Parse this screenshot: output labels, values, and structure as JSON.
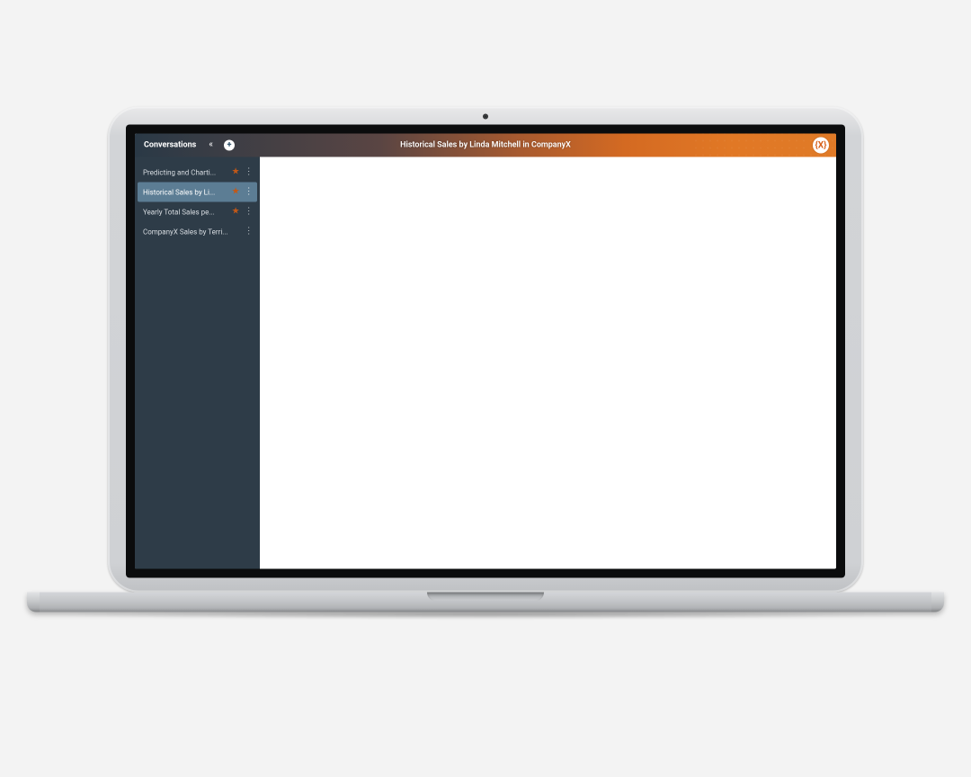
{
  "header": {
    "sidebar_title": "Conversations",
    "page_title": "Historical Sales by Linda Mitchell in CompanyX",
    "logo_text": "{X}",
    "add_icon": "+",
    "collapse_icon": "«"
  },
  "sidebar": {
    "items": [
      {
        "label": "Predicting and Charti...",
        "starred": true,
        "active": false
      },
      {
        "label": "Historical Sales by Li...",
        "starred": true,
        "active": true
      },
      {
        "label": "Yearly Total Sales pe...",
        "starred": true,
        "active": false
      },
      {
        "label": "CompanyX Sales by Terri...",
        "starred": false,
        "active": false
      }
    ],
    "kebab_glyph": "⋮",
    "star_glyph": "★"
  }
}
